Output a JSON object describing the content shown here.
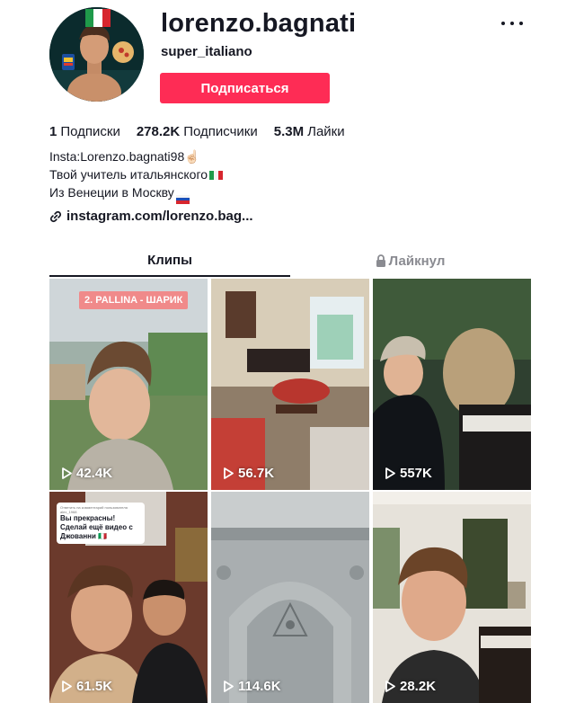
{
  "profile": {
    "username": "lorenzo.bagnati",
    "nickname": "super_italiano",
    "follow_label": "Подписаться",
    "more_icon": "more-horizontal-icon"
  },
  "stats": [
    {
      "value": "1",
      "label": "Подписки"
    },
    {
      "value": "278.2K",
      "label": "Подписчики"
    },
    {
      "value": "5.3M",
      "label": "Лайки"
    }
  ],
  "bio": {
    "line1": "Insta:Lorenzo.bagnati98",
    "line1_emoji": "☝🏻",
    "line2": "Твой учитель итальянского",
    "line3": "Из Венеции в Москву",
    "link": "instagram.com/lorenzo.bag..."
  },
  "tabs": {
    "clips": "Клипы",
    "liked": "Лайкнул"
  },
  "videos": [
    {
      "views": "42.4K",
      "badge": "2. PALLINA - ШАРИК"
    },
    {
      "views": "56.7K"
    },
    {
      "views": "557K"
    },
    {
      "views": "61.5K",
      "reply_small": "Ответить на комментарий пользователя alex_1968",
      "reply_text": "Вы прекрасны! Сделай ещё видео с Джованни 🇮🇹"
    },
    {
      "views": "114.6K"
    },
    {
      "views": "28.2K"
    }
  ],
  "colors": {
    "accent": "#fe2c55",
    "text": "#161823",
    "muted": "#8a8b91"
  }
}
